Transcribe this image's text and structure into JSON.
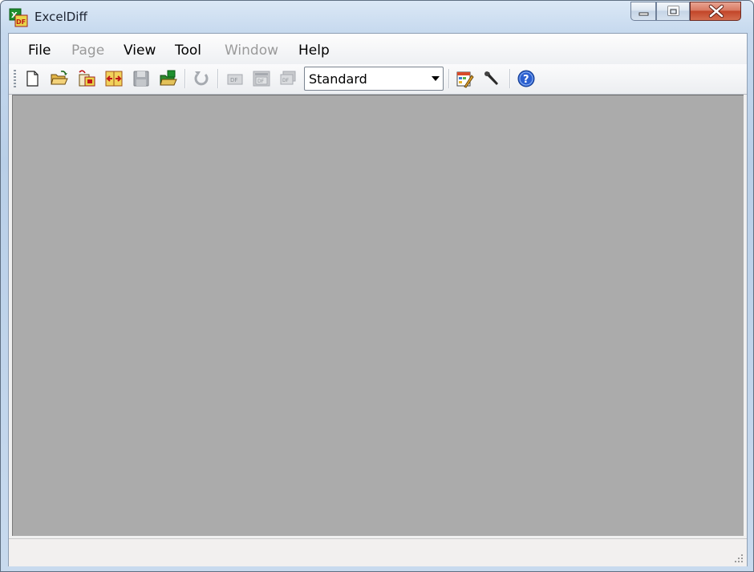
{
  "window": {
    "title": "ExcelDiff",
    "icon": "exceldiff-app-icon",
    "controls": [
      "minimize-icon",
      "maximize-icon",
      "close-icon"
    ]
  },
  "menu": [
    {
      "label": "File",
      "enabled": true
    },
    {
      "label": "Page",
      "enabled": false
    },
    {
      "label": "View",
      "enabled": true
    },
    {
      "label": "Tool",
      "enabled": true
    },
    {
      "label": "Window",
      "enabled": false
    },
    {
      "label": "Help",
      "enabled": true
    }
  ],
  "toolbar": {
    "buttons": [
      {
        "icon": "new-document-icon",
        "enabled": true
      },
      {
        "icon": "open-folder-icon",
        "enabled": true
      },
      {
        "icon": "open-recent-icon",
        "enabled": true
      },
      {
        "icon": "compare-icon",
        "enabled": true
      },
      {
        "icon": "save-icon",
        "enabled": false
      },
      {
        "icon": "open-result-icon",
        "enabled": true
      },
      {
        "icon": "refresh-icon",
        "enabled": false
      },
      {
        "icon": "diff-prev-icon",
        "enabled": false
      },
      {
        "icon": "diff-view-icon",
        "enabled": false
      },
      {
        "icon": "diff-next-icon",
        "enabled": false
      },
      {
        "icon": "options-icon",
        "enabled": true
      },
      {
        "icon": "tools-wrench-icon",
        "enabled": true
      },
      {
        "icon": "help-icon",
        "enabled": true
      }
    ],
    "mode_select": {
      "value": "Standard"
    }
  },
  "statusbar": {
    "text": ""
  }
}
